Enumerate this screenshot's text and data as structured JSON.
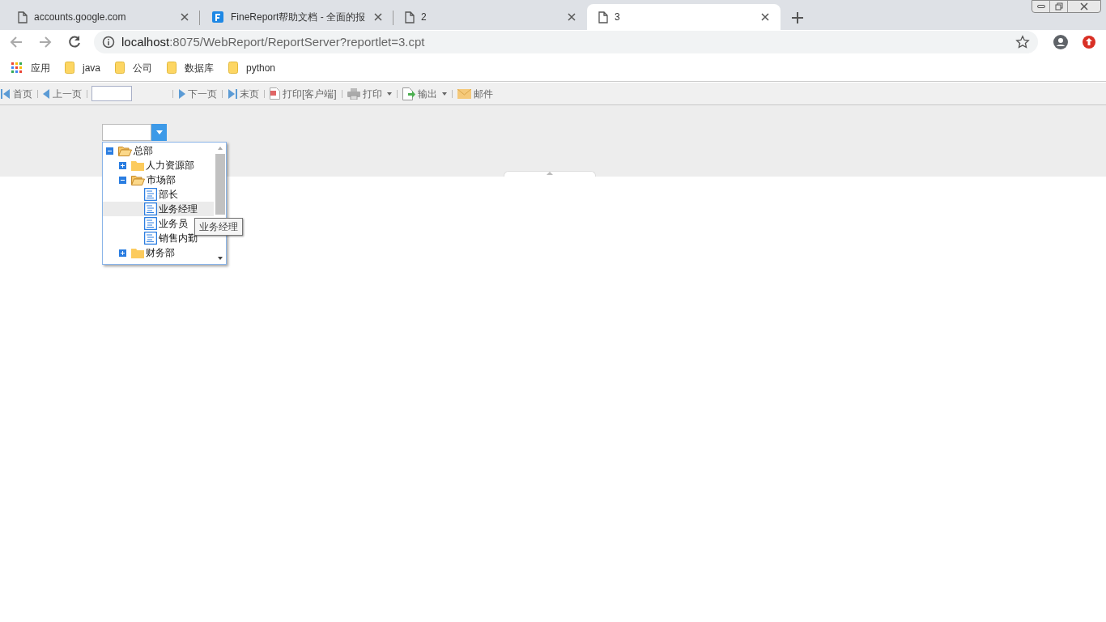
{
  "tabs": [
    {
      "title": "accounts.google.com",
      "kind": "page",
      "selected": false
    },
    {
      "title": "FineReport帮助文档 - 全面的报",
      "kind": "brand",
      "selected": false
    },
    {
      "title": "2",
      "kind": "page",
      "selected": false
    },
    {
      "title": "3",
      "kind": "page",
      "selected": true
    }
  ],
  "address": {
    "host": "localhost",
    "rest": ":8075/WebReport/ReportServer?reportlet=3.cpt"
  },
  "bookmarks": [
    {
      "label": "应用",
      "kind": "apps"
    },
    {
      "label": "java",
      "kind": "folder"
    },
    {
      "label": "公司",
      "kind": "folder"
    },
    {
      "label": "数据库",
      "kind": "folder"
    },
    {
      "label": "python",
      "kind": "folder"
    }
  ],
  "toolbar": [
    {
      "label": "首页",
      "kind": "first"
    },
    {
      "label": "上一页",
      "kind": "prev"
    },
    {
      "kind": "page-input"
    },
    {
      "label": "下一页",
      "kind": "next"
    },
    {
      "label": "末页",
      "kind": "last"
    },
    {
      "label": "打印[客户端]",
      "kind": "flash"
    },
    {
      "label": "打印",
      "kind": "print",
      "dropdown": true
    },
    {
      "label": "输出",
      "kind": "export",
      "dropdown": true
    },
    {
      "label": "邮件",
      "kind": "mail"
    }
  ],
  "tree": [
    {
      "label": "总部",
      "kind": "folder",
      "expanded": true,
      "selected": false,
      "children": [
        {
          "label": "人力资源部",
          "kind": "folder",
          "expanded": false,
          "selected": false
        },
        {
          "label": "市场部",
          "kind": "folder",
          "expanded": true,
          "selected": false,
          "children": [
            {
              "label": "部长",
              "kind": "leaf",
              "selected": false
            },
            {
              "label": "业务经理",
              "kind": "leaf",
              "selected": true
            },
            {
              "label": "业务员",
              "kind": "leaf",
              "selected": false
            },
            {
              "label": "销售内勤",
              "kind": "leaf",
              "selected": false
            }
          ]
        },
        {
          "label": "财务部",
          "kind": "folder",
          "expanded": false,
          "selected": false
        }
      ]
    }
  ],
  "tooltip": "业务经理"
}
